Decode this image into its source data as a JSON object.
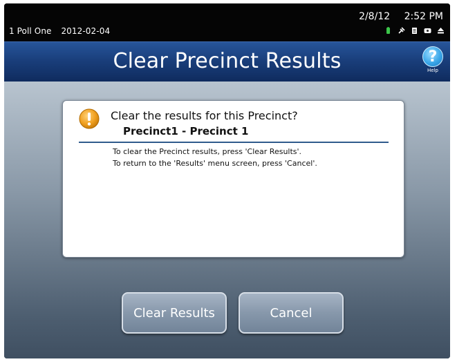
{
  "status": {
    "poll": "1 Poll One",
    "date_long": "2012-02-04",
    "date_short": "2/8/12",
    "time": "2:52 PM",
    "icons": [
      "battery-icon",
      "plug-icon",
      "document-icon",
      "card-icon",
      "eject-icon"
    ]
  },
  "header": {
    "title": "Clear Precinct Results",
    "help_glyph": "?",
    "help_label": "Help"
  },
  "dialog": {
    "question": "Clear the results for this Precinct?",
    "precinct": "Precinct1 - Precinct 1",
    "instruction_1": "To clear the Precinct results, press 'Clear Results'.",
    "instruction_2": "To return to the 'Results' menu screen, press 'Cancel'.",
    "warning_glyph": "!"
  },
  "buttons": {
    "clear": "Clear Results",
    "cancel": "Cancel"
  },
  "colors": {
    "title_bar": "#1a3f7c",
    "warning": "#f0a020",
    "help": "#3aa6e8",
    "button": "#8798ab"
  }
}
